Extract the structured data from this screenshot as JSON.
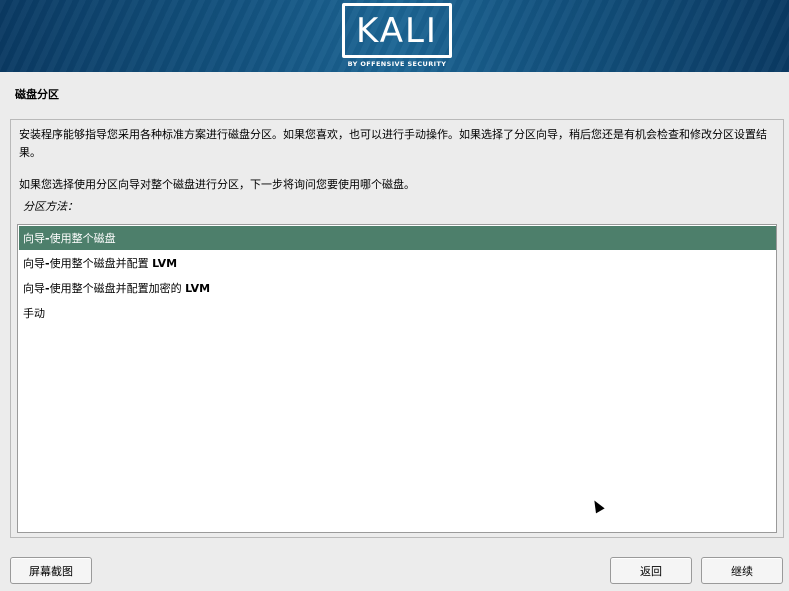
{
  "banner": {
    "logo_text": "KALI",
    "logo_subtitle": "BY OFFENSIVE SECURITY"
  },
  "page": {
    "title": "磁盘分区",
    "description_1": "安装程序能够指导您采用各种标准方案进行磁盘分区。如果您喜欢，也可以进行手动操作。如果选择了分区向导，稍后您还是有机会检查和修改分区设置结果。",
    "description_2": "如果您选择使用分区向导对整个磁盘进行分区，下一步将询问您要使用哪个磁盘。",
    "method_label": "分区方法："
  },
  "options": [
    {
      "prefix": "向导",
      "sep": " - ",
      "text": "使用整个磁盘",
      "suffix": "",
      "selected": true
    },
    {
      "prefix": "向导",
      "sep": " - ",
      "text": "使用整个磁盘并配置 ",
      "suffix": "LVM",
      "selected": false
    },
    {
      "prefix": "向导",
      "sep": " - ",
      "text": "使用整个磁盘并配置加密的 ",
      "suffix": "LVM",
      "selected": false
    },
    {
      "prefix": "手动",
      "sep": "",
      "text": "",
      "suffix": "",
      "selected": false
    }
  ],
  "buttons": {
    "screenshot": "屏幕截图",
    "back": "返回",
    "continue": "继续"
  },
  "colors": {
    "banner": "#13527f",
    "selection": "#4d7f6b",
    "background": "#ececec"
  }
}
